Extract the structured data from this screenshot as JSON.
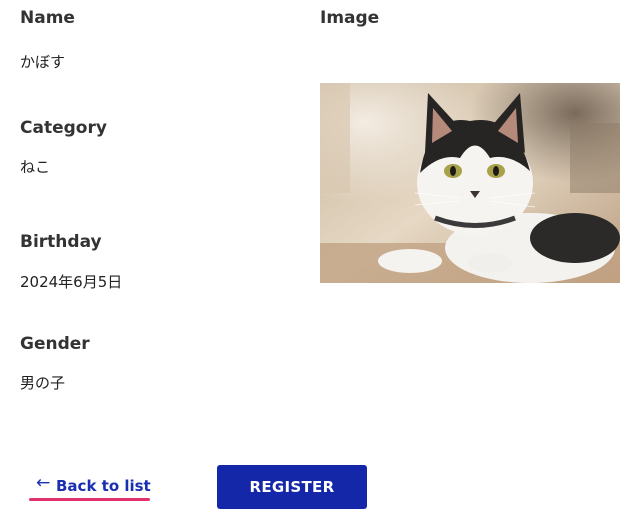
{
  "fields": {
    "name": {
      "label": "Name",
      "value": "かぼす"
    },
    "category": {
      "label": "Category",
      "value": "ねこ"
    },
    "birthday": {
      "label": "Birthday",
      "value": "2024年6月5日"
    },
    "gender": {
      "label": "Gender",
      "value": "男の子"
    },
    "image": {
      "label": "Image"
    }
  },
  "actions": {
    "back_arrow": "←",
    "back_label": "Back to list",
    "register_label": "REGISTER"
  },
  "colors": {
    "link": "#1a2fb0",
    "link_underline": "#e0336d",
    "primary_button": "#1327a8"
  },
  "icons": {
    "back": "arrow-left-icon"
  }
}
